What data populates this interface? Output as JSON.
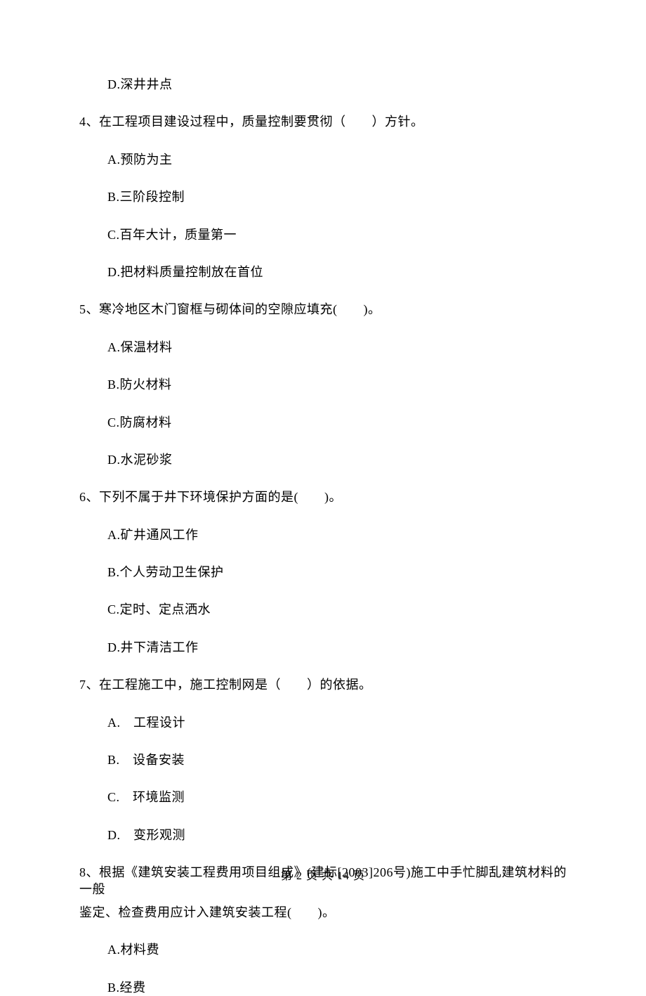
{
  "questions": {
    "q3": {
      "options": {
        "d": "D.深井井点"
      }
    },
    "q4": {
      "stem": "4、在工程项目建设过程中，质量控制要贯彻（　　）方针。",
      "options": {
        "a": "A.预防为主",
        "b": "B.三阶段控制",
        "c": "C.百年大计，质量第一",
        "d": "D.把材料质量控制放在首位"
      }
    },
    "q5": {
      "stem": "5、寒冷地区木门窗框与砌体间的空隙应填充(　　)。",
      "options": {
        "a": "A.保温材料",
        "b": "B.防火材料",
        "c": "C.防腐材料",
        "d": "D.水泥砂浆"
      }
    },
    "q6": {
      "stem": "6、下列不属于井下环境保护方面的是(　　)。",
      "options": {
        "a": "A.矿井通风工作",
        "b": "B.个人劳动卫生保护",
        "c": "C.定时、定点洒水",
        "d": "D.井下清洁工作"
      }
    },
    "q7": {
      "stem": "7、在工程施工中，施工控制网是（　　）的依据。",
      "options": {
        "a": "A.　工程设计",
        "b": "B.　设备安装",
        "c": "C.　环境监测",
        "d": "D.　变形观测"
      }
    },
    "q8": {
      "stem_line1": "8、根据《建筑安装工程费用项目组成》(建标[2003]206号)施工中手忙脚乱建筑材料的一般",
      "stem_line2": "鉴定、检查费用应计入建筑安装工程(　　)。",
      "options": {
        "a": "A.材料费",
        "b": "B.经费"
      }
    }
  },
  "footer": "第 2 页 共 14 页"
}
